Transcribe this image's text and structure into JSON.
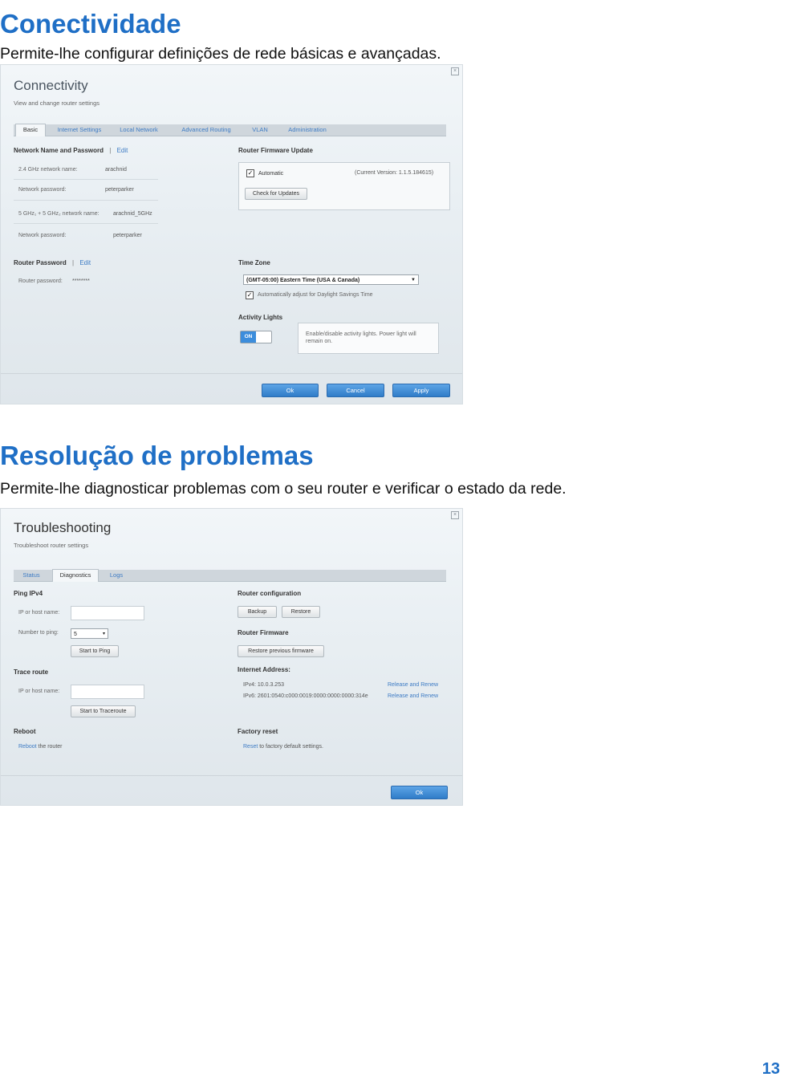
{
  "sections": [
    {
      "heading": "Conectividade",
      "description": "Permite-lhe configurar definições de rede básicas e avançadas."
    },
    {
      "heading": "Resolução de problemas",
      "description": "Permite-lhe diagnosticar problemas com o seu router e verificar o estado da rede."
    }
  ],
  "connectivity": {
    "close_glyph": "×",
    "title": "Connectivity",
    "subtitle": "View and change router settings",
    "tabs": [
      "Basic",
      "Internet Settings",
      "Local Network",
      "Advanced Routing",
      "VLAN",
      "Administration"
    ],
    "active_tab": "Basic",
    "network": {
      "heading": "Network Name and Password",
      "separator": "|",
      "edit": "Edit",
      "rows": [
        {
          "label": "2.4 GHz network name:",
          "value": "arachnid"
        },
        {
          "label": "Network password:",
          "value": "peterparker"
        },
        {
          "label": "5 GHz₁ + 5 GHz₂ network name:",
          "value": "arachnid_5GHz"
        },
        {
          "label": "Network password:",
          "value": "peterparker"
        }
      ]
    },
    "router_password": {
      "heading": "Router Password",
      "separator": "|",
      "edit": "Edit",
      "label": "Router password:",
      "value": "********"
    },
    "firmware": {
      "heading": "Router Firmware Update",
      "check_glyph": "✓",
      "automatic": "Automatic",
      "version": "(Current Version: 1.1.5.184615)",
      "check_button": "Check for Updates"
    },
    "timezone": {
      "heading": "Time Zone",
      "selected": "(GMT-05:00) Eastern Time (USA & Canada)",
      "arrow": "▼",
      "check_glyph": "✓",
      "dst_label": "Automatically adjust for Daylight Savings Time"
    },
    "activity": {
      "heading": "Activity Lights",
      "toggle": "ON",
      "note": "Enable/disable activity lights. Power light will remain on."
    },
    "buttons": {
      "ok": "Ok",
      "cancel": "Cancel",
      "apply": "Apply"
    }
  },
  "troubleshooting": {
    "close_glyph": "×",
    "title": "Troubleshooting",
    "subtitle": "Troubleshoot router settings",
    "tabs": [
      "Status",
      "Diagnostics",
      "Logs"
    ],
    "active_tab": "Diagnostics",
    "ping": {
      "heading": "Ping IPv4",
      "host_label": "IP or host name:",
      "count_label": "Number to ping:",
      "count_value": "5",
      "arrow": "▾",
      "button": "Start to Ping"
    },
    "trace": {
      "heading": "Trace route",
      "host_label": "IP or host name:",
      "button": "Start to Traceroute"
    },
    "reboot": {
      "heading": "Reboot",
      "link": "Reboot",
      "text": " the router"
    },
    "config": {
      "heading": "Router configuration",
      "backup": "Backup",
      "restore": "Restore"
    },
    "firmware": {
      "heading": "Router Firmware",
      "button": "Restore previous firmware"
    },
    "internet": {
      "heading": "Internet Address:",
      "ipv4": "IPv4: 10.0.3.253",
      "ipv6": "IPv6: 2601:0540:c000:0019:0000:0000:0000:314e",
      "ipv4_action": "Release and Renew",
      "ipv6_action": "Release and Renew"
    },
    "factory": {
      "heading": "Factory reset",
      "link": "Reset",
      "text": " to factory default settings."
    },
    "buttons": {
      "ok": "Ok"
    }
  },
  "page_number": "13"
}
